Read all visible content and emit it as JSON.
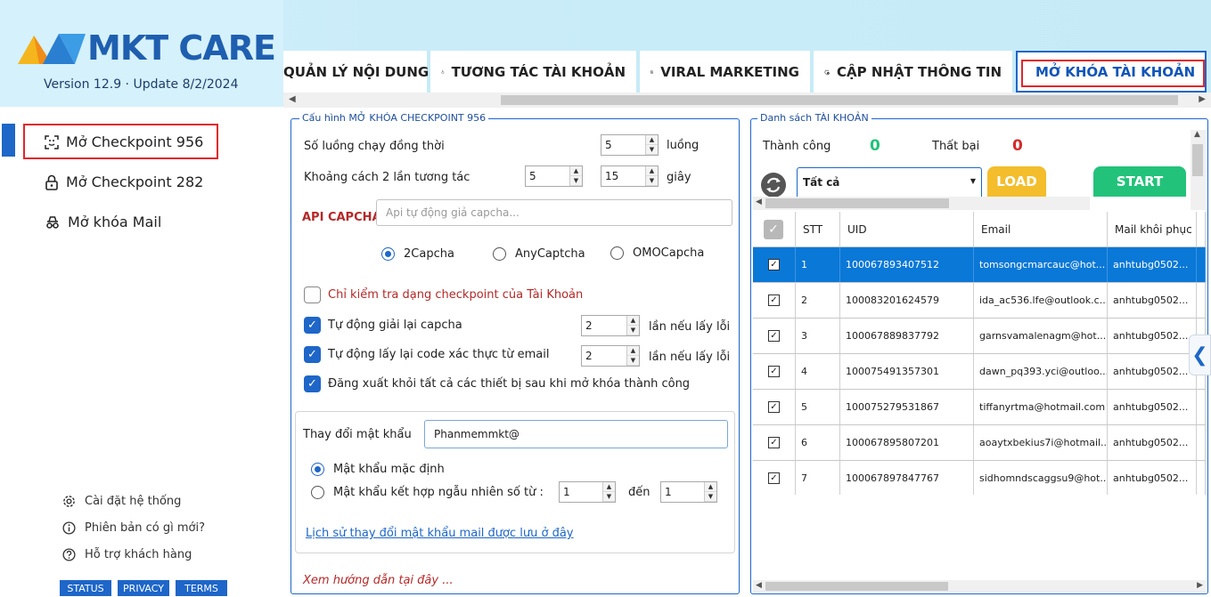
{
  "app": {
    "logo_text": "MKT CARE",
    "version": "Version  12.9 · Update  8/2/2024"
  },
  "tabs": [
    {
      "label": "QUẢN LÝ NỘI DUNG",
      "icon": "content-icon"
    },
    {
      "label": "TƯƠNG TÁC TÀI KHOẢN",
      "icon": "hand-pointer-icon"
    },
    {
      "label": "VIRAL MARKETING",
      "icon": "grid-icon"
    },
    {
      "label": "CẬP NHẬT THÔNG TIN",
      "icon": "refresh-check-icon"
    },
    {
      "label": "MỞ KHÓA TÀI KHOẢN",
      "icon": "fingerprint-icon",
      "active": true
    }
  ],
  "sidebar": {
    "items": [
      {
        "label": "Mở Checkpoint 956",
        "icon": "face-scan-icon",
        "selected": true
      },
      {
        "label": "Mở Checkpoint 282",
        "icon": "lock-icon"
      },
      {
        "label": "Mở khóa Mail",
        "icon": "spy-icon"
      }
    ],
    "footer": [
      {
        "label": "Cài đặt hệ thống",
        "icon": "gear-icon"
      },
      {
        "label": "Phiên bản có gì mới?",
        "icon": "info-icon"
      },
      {
        "label": "Hỗ trợ khách hàng",
        "icon": "help-icon"
      }
    ],
    "buttons": [
      "STATUS",
      "PRIVACY",
      "TERMS"
    ]
  },
  "config": {
    "legend": "Cấu hình MỞ KHÓA CHECKPOINT 956",
    "threads_label": "Số luồng chạy đồng thời",
    "threads_value": "5",
    "threads_unit": "luồng",
    "interval_label": "Khoảng cách 2 lần tương tác",
    "interval_from": "5",
    "interval_to": "15",
    "interval_unit": "giây",
    "captcha_label": "API CAPCHA",
    "captcha_placeholder": "Api tự động giả capcha...",
    "captcha_options": [
      "2Capcha",
      "AnyCaptcha",
      "OMOCapcha"
    ],
    "captcha_selected": "2Capcha",
    "check_only": "Chỉ kiểm tra dạng checkpoint của Tài Khoản",
    "auto_captcha": "Tự động giải lại capcha",
    "auto_captcha_value": "2",
    "retry_unit": "lần nếu lấy lỗi",
    "auto_email_code": "Tự động lấy lại code xác thực từ email",
    "auto_email_value": "2",
    "logout_all": "Đăng xuất khỏi tất cả các thiết bị sau khi mở khóa thành công",
    "change_pw_label": "Thay đổi mật khẩu",
    "change_pw_value": "Phanmemmkt@",
    "pw_default": "Mật khẩu mặc định",
    "pw_random": "Mật khẩu kết hợp ngẫu nhiên số từ :",
    "pw_from": "1",
    "pw_to_label": "đến",
    "pw_to": "1",
    "history_link": "Lịch sử thay đổi mật khẩu mail được lưu ở đây",
    "guide": "Xem hướng dẫn tại đây ..."
  },
  "accounts": {
    "legend": "Danh sách TÀI KHOẢN",
    "success_label": "Thành công",
    "success_value": "0",
    "fail_label": "Thất bại",
    "fail_value": "0",
    "filter_value": "Tất cả",
    "load_label": "LOAD",
    "start_label": "START",
    "columns": [
      "STT",
      "UID",
      "Email",
      "Mail khôi phục"
    ],
    "rows": [
      {
        "stt": "1",
        "uid": "100067893407512",
        "email": "tomsongcmarcauc@hot...",
        "recovery": "anhtubg0502...",
        "selected": true
      },
      {
        "stt": "2",
        "uid": "100083201624579",
        "email": "ida_ac536.lfe@outlook.c...",
        "recovery": "anhtubg0502..."
      },
      {
        "stt": "3",
        "uid": "100067889837792",
        "email": "garnsvamalenagm@hot...",
        "recovery": "anhtubg0502..."
      },
      {
        "stt": "4",
        "uid": "100075491357301",
        "email": "dawn_pq393.yci@outloo...",
        "recovery": "anhtubg0502..."
      },
      {
        "stt": "5",
        "uid": "100075279531867",
        "email": "tiffanyrtma@hotmail.com",
        "recovery": "anhtubg0502..."
      },
      {
        "stt": "6",
        "uid": "100067895807201",
        "email": "aoaytxbekius7i@hotmail....",
        "recovery": "anhtubg0502..."
      },
      {
        "stt": "7",
        "uid": "100067897847767",
        "email": "sidhomndscaggsu9@hot...",
        "recovery": "anhtubg0502..."
      }
    ]
  }
}
